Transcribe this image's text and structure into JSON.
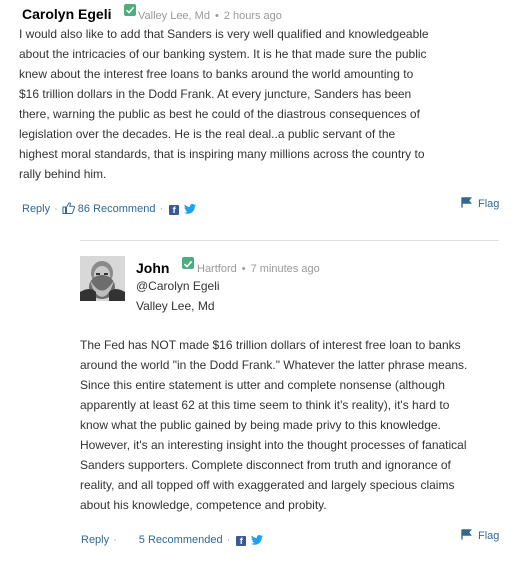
{
  "comment1": {
    "author": "Carolyn Egeli",
    "location": "Valley Lee, Md",
    "separator": "•",
    "time": "2 hours ago",
    "lines": [
      "I would also like to add that Sanders is very well qualified and knowledgeable",
      "about the intricacies of our banking system. It is he that made sure the public",
      "knew about the interest free loans to banks around the world amounting to",
      "$16 trillion dollars in the Dodd Frank. At every juncture, Sanders has been",
      "there, warning the public as best he could of the diastrous consequences of",
      "legislation over the decades. He is the real deal..a public servant of the",
      "highest moral standards, that is inspiring many millions across the country to",
      "rally behind him."
    ],
    "reply_label": "Reply",
    "recommend_label": "86 Recommend",
    "flag_label": "Flag"
  },
  "comment2": {
    "author": "John",
    "location": "Hartford",
    "separator": "•",
    "time": "7 minutes ago",
    "reply_to": "@Carolyn Egeli",
    "reply_to_location": "Valley Lee, Md",
    "lines": [
      "The Fed has NOT made $16 trillion dollars of interest free loan to banks",
      "around the world \"in the Dodd Frank.\" Whatever the latter phrase means.",
      "Since this entire statement is utter and complete nonsense (although",
      "apparently at least 62 at this time seem to think it's reality), it's hard to",
      "know what the public gained by being made privy to this knowledge.",
      "However, it's an interesting insight into the thought processes of fanatical",
      "Sanders supporters. Complete disconnect from truth and ignorance of",
      "reality, and all topped off with exaggerated and largely specious claims",
      "about his knowledge, competence and probity."
    ],
    "reply_label": "Reply",
    "recommend_label": "5 Recommended",
    "flag_label": "Flag"
  },
  "icons": {
    "verified": "verified-check-icon",
    "thumb": "thumbs-up-icon",
    "facebook": "facebook-icon",
    "twitter": "twitter-icon",
    "flag": "flag-icon"
  },
  "colors": {
    "link": "#326891",
    "verified": "#4cae7d",
    "facebook": "#3b5998",
    "twitter": "#1da1f2"
  }
}
